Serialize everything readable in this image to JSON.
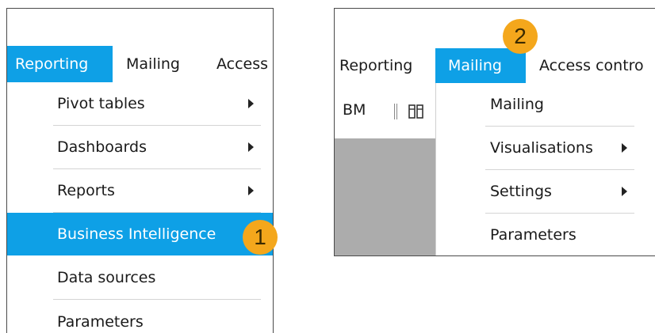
{
  "left": {
    "menubar": {
      "reporting": "Reporting",
      "mailing": "Mailing",
      "access": "Access"
    },
    "menu": [
      {
        "label": "Pivot tables",
        "submenu": true
      },
      {
        "label": "Dashboards",
        "submenu": true
      },
      {
        "label": "Reports",
        "submenu": true
      },
      {
        "label": "Business Intelligence",
        "submenu": true,
        "highlighted": true
      },
      {
        "label": "Data sources",
        "submenu": false
      },
      {
        "label": "Parameters",
        "submenu": false
      }
    ],
    "badge": "1"
  },
  "right": {
    "menubar": {
      "reporting": "Reporting",
      "mailing": "Mailing",
      "access": "Access contro"
    },
    "toolbar": {
      "bm_label": "BM"
    },
    "menu": [
      {
        "label": "Mailing",
        "submenu": false
      },
      {
        "label": "Visualisations",
        "submenu": true
      },
      {
        "label": "Settings",
        "submenu": true
      },
      {
        "label": "Parameters",
        "submenu": false
      }
    ],
    "badge": "2"
  },
  "colors": {
    "accent": "#0ea0e6",
    "badge": "#f4a71c",
    "canvas": "#acacac"
  }
}
